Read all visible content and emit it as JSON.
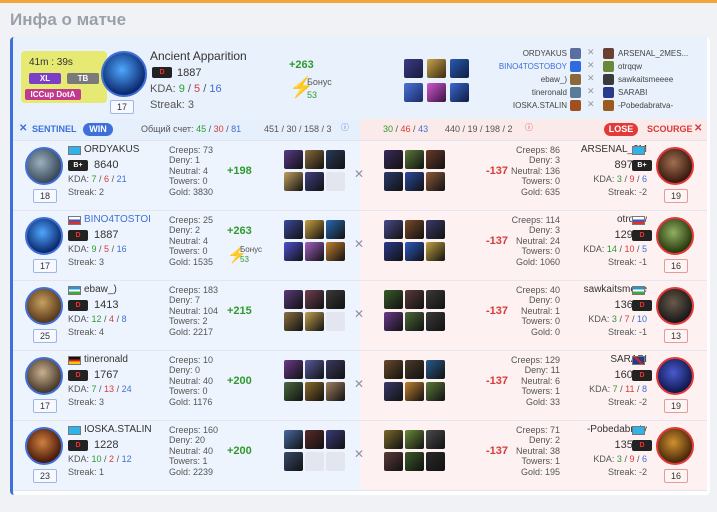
{
  "page_title": "Инфа о матче",
  "summary": {
    "time": "41m : 39s",
    "tags": [
      "XL",
      "TB",
      "ICCup DotA"
    ],
    "hero_name": "Ancient Apparition",
    "rank": "D",
    "rating": "1887",
    "kda_label": "KDA:",
    "kda_k": "9",
    "kda_d": "5",
    "kda_a": "16",
    "streak": "Streak: 3",
    "level": "17",
    "gain": "+263",
    "bonus_label": "Бонус",
    "bonus_value": "53",
    "sentinel_players": [
      "ORDYAKUS",
      "BINO4TOSTOBOY",
      "ebaw_)",
      "tineronald",
      "IOSKA.STALIN"
    ],
    "scourge_players": [
      "ARSENAL_2MES...",
      "otrqqw",
      "sawkaitsmeeee",
      "SARABI",
      "-Pobedabratva-"
    ]
  },
  "scorebar": {
    "sentinel": "SENTINEL",
    "win": "WIN",
    "total_label": "Общий счет:",
    "s_k": "45",
    "s_d": "30",
    "s_a": "81",
    "s_cs": "451 / 30 / 158 / 3",
    "r_k": "30",
    "r_d": "46",
    "r_a": "43",
    "r_cs": "440 / 19 / 198 / 2",
    "lose": "LOSE",
    "scourge": "SCOURGE"
  },
  "rows": [
    {
      "l": {
        "name": "ORDYAKUS",
        "rank": "B+",
        "rating": "8640",
        "k": "7",
        "d": "6",
        "a": "21",
        "streak": "Streak: 2",
        "level": "18",
        "creeps": "Creeps: 73",
        "deny": "Deny: 1",
        "neutral": "Neutral: 4",
        "towers": "Towers: 0",
        "gold": "Gold: 3830",
        "gain": "+198",
        "bonus": "",
        "bonus_val": ""
      },
      "r": {
        "name": "ARSENAL_2M",
        "rank": "B+",
        "rating": "8974",
        "k": "3",
        "d": "9",
        "a": "6",
        "streak": "Streak: -2",
        "level": "19",
        "creeps": "Creeps: 86",
        "deny": "Deny: 3",
        "neutral": "Neutral: 136",
        "towers": "Towers: 0",
        "gold": "Gold: 635",
        "loss": "-137"
      }
    },
    {
      "l": {
        "name": "BINO4TOSTOI",
        "rank": "D",
        "rating": "1887",
        "k": "9",
        "d": "5",
        "a": "16",
        "streak": "Streak: 3",
        "level": "17",
        "creeps": "Creeps: 25",
        "deny": "Deny: 2",
        "neutral": "Neutral: 4",
        "towers": "Towers: 0",
        "gold": "Gold: 1535",
        "gain": "+263",
        "bonus": "Бонус",
        "bonus_val": "53"
      },
      "r": {
        "name": "otrqqw",
        "rank": "D",
        "rating": "1290",
        "k": "14",
        "d": "10",
        "a": "5",
        "streak": "Streak: -1",
        "level": "16",
        "creeps": "Creeps: 114",
        "deny": "Deny: 3",
        "neutral": "Neutral: 24",
        "towers": "Towers: 0",
        "gold": "Gold: 1060",
        "loss": "-137"
      }
    },
    {
      "l": {
        "name": "ebaw_)",
        "rank": "D",
        "rating": "1413",
        "k": "12",
        "d": "4",
        "a": "8",
        "streak": "Streak: 4",
        "level": "25",
        "creeps": "Creeps: 183",
        "deny": "Deny: 7",
        "neutral": "Neutral: 104",
        "towers": "Towers: 2",
        "gold": "Gold: 2217",
        "gain": "+215",
        "bonus": "",
        "bonus_val": ""
      },
      "r": {
        "name": "sawkaitsmeee",
        "rank": "D",
        "rating": "1366",
        "k": "3",
        "d": "7",
        "a": "10",
        "streak": "Streak: -1",
        "level": "13",
        "creeps": "Creeps: 40",
        "deny": "Deny: 0",
        "neutral": "Neutral: 1",
        "towers": "Towers: 0",
        "gold": "Gold: 0",
        "loss": "-137"
      }
    },
    {
      "l": {
        "name": "tineronald",
        "rank": "D",
        "rating": "1767",
        "k": "7",
        "d": "13",
        "a": "24",
        "streak": "Streak: 3",
        "level": "17",
        "creeps": "Creeps: 10",
        "deny": "Deny: 0",
        "neutral": "Neutral: 40",
        "towers": "Towers: 0",
        "gold": "Gold: 1176",
        "gain": "+200",
        "bonus": "",
        "bonus_val": ""
      },
      "r": {
        "name": "SARABI",
        "rank": "D",
        "rating": "1603",
        "k": "7",
        "d": "11",
        "a": "8",
        "streak": "Streak: -2",
        "level": "19",
        "creeps": "Creeps: 129",
        "deny": "Deny: 11",
        "neutral": "Neutral: 6",
        "towers": "Towers: 1",
        "gold": "Gold: 33",
        "loss": "-137"
      }
    },
    {
      "l": {
        "name": "IOSKA.STALIN",
        "rank": "D",
        "rating": "1228",
        "k": "10",
        "d": "2",
        "a": "12",
        "streak": "Streak: 1",
        "level": "23",
        "creeps": "Creeps: 160",
        "deny": "Deny: 20",
        "neutral": "Neutral: 40",
        "towers": "Towers: 1",
        "gold": "Gold: 2239",
        "gain": "+200",
        "bonus": "",
        "bonus_val": ""
      },
      "r": {
        "name": "-Pobedabratv",
        "rank": "D",
        "rating": "1350",
        "k": "3",
        "d": "9",
        "a": "6",
        "streak": "Streak: -2",
        "level": "16",
        "creeps": "Creeps: 71",
        "deny": "Deny: 2",
        "neutral": "Neutral: 38",
        "towers": "Towers: 1",
        "gold": "Gold: 195",
        "loss": "-137"
      }
    }
  ],
  "colors": {
    "sentinel": "#3f6fd9",
    "scourge": "#e03a3a",
    "gain": "#2e9a2e",
    "accent": "#f3a53a"
  }
}
